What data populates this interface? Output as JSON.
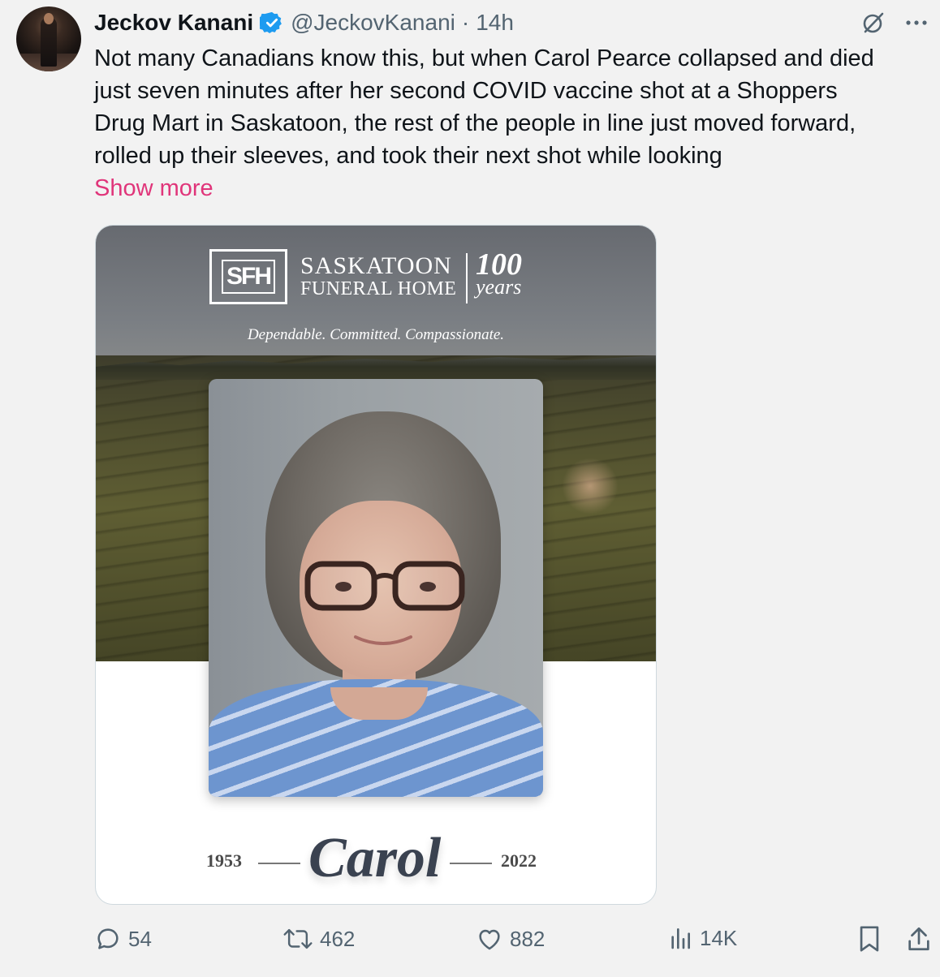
{
  "author": {
    "name": "Jeckov Kanani",
    "handle": "@JeckovKanani",
    "separator": "·",
    "time": "14h",
    "verified": true
  },
  "tweet": {
    "lines": [
      "Not many Canadians know this, but when Carol Pearce collapsed and died",
      "just seven minutes after her second COVID vaccine shot at a Shoppers",
      "Drug Mart in Saskatoon, the rest of the people in line just moved forward,",
      "rolled up their sleeves, and took their next shot while looking"
    ],
    "show_more": "Show more"
  },
  "media": {
    "logo_abbr": "SFH",
    "logo_line1": "SASKATOON",
    "logo_line2": "FUNERAL HOME",
    "logo_years_num": "100",
    "logo_years_word": "years",
    "tagline": "Dependable. Committed. Compassionate.",
    "birth_year": "1953",
    "first_name": "Carol",
    "death_year": "2022"
  },
  "actions": {
    "replies": "54",
    "reposts": "462",
    "likes": "882",
    "views": "14K"
  },
  "colors": {
    "link": "#e0357a",
    "muted": "#536471",
    "verified": "#1d9bf0",
    "background": "#f2f2f2"
  },
  "icons": [
    "grok-icon",
    "more-icon",
    "reply-icon",
    "repost-icon",
    "like-icon",
    "views-icon",
    "bookmark-icon",
    "share-icon"
  ]
}
